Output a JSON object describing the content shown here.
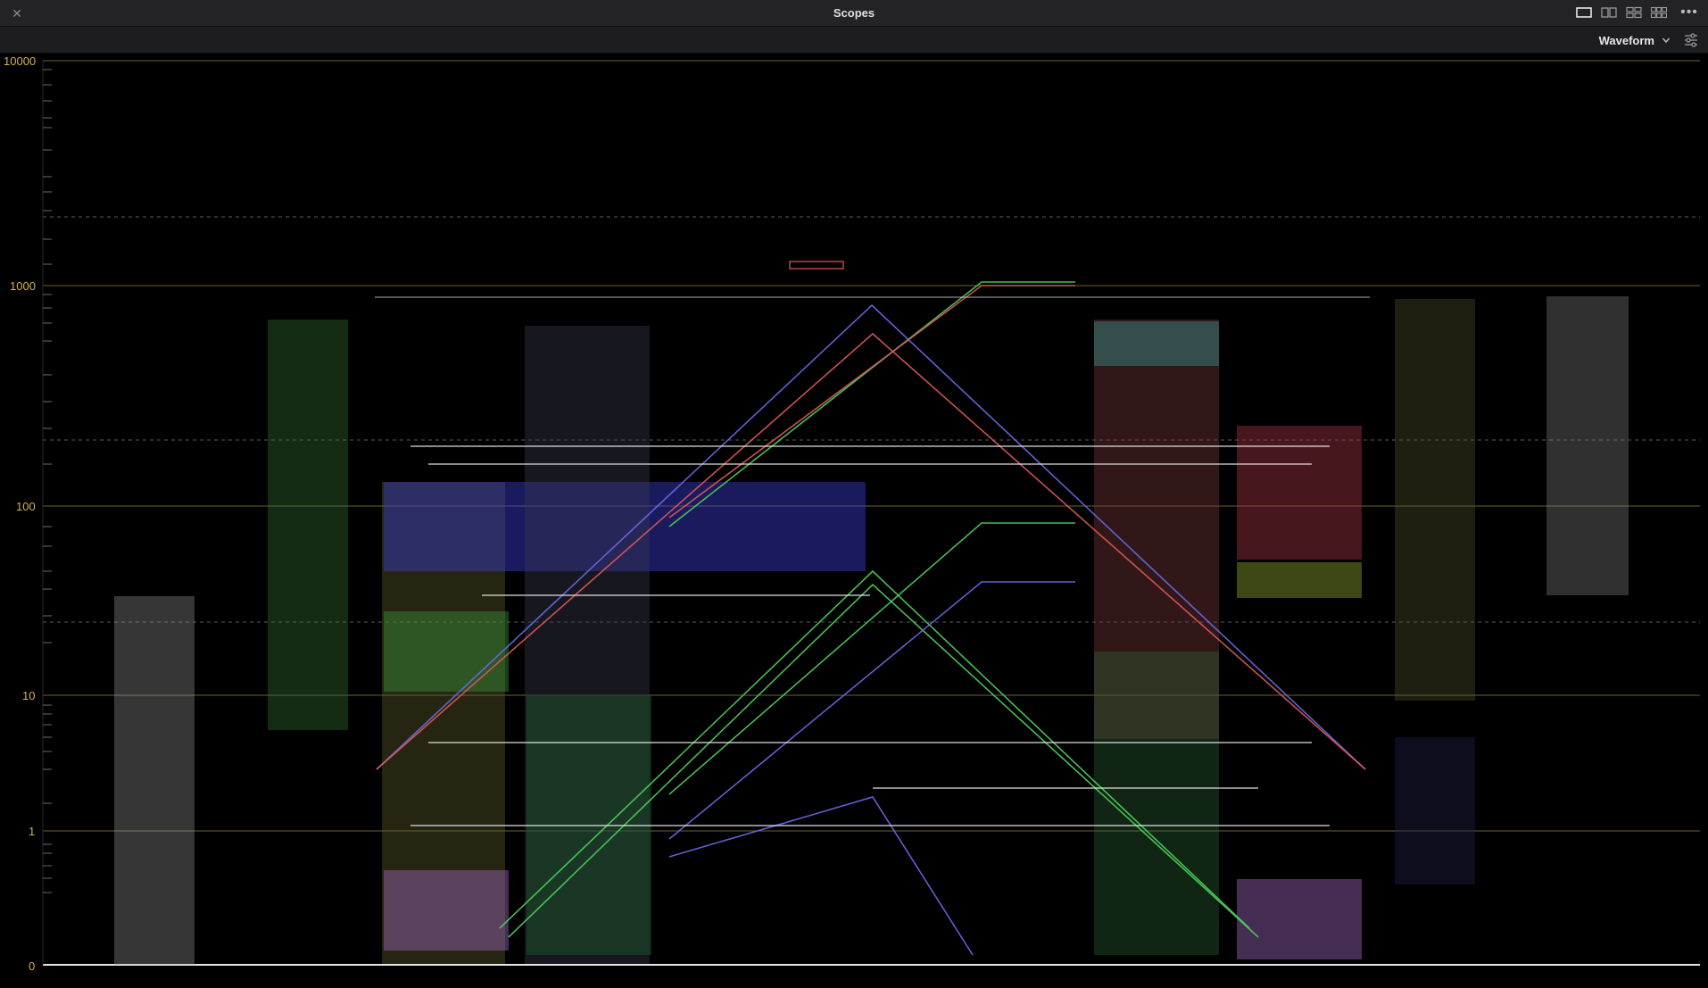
{
  "window": {
    "title": "Scopes",
    "close_icon": "close-icon",
    "layout_buttons": [
      "single-view-icon",
      "dual-view-icon",
      "quad-view-icon",
      "six-view-icon"
    ],
    "more_icon": "more-icon"
  },
  "toolbar": {
    "scope_type": "Waveform",
    "dropdown_icon": "chevron-down-icon",
    "settings_icon": "settings-icon"
  },
  "scope": {
    "scale": "log",
    "unit_ticks": [
      "10000",
      "1000",
      "100",
      "10",
      "1",
      "0"
    ],
    "colors": {
      "red": "#e05a5a",
      "green": "#4fd05a",
      "blue": "#6a6ae8",
      "white": "#e8e8e8",
      "tick": "#d4b24c"
    }
  }
}
